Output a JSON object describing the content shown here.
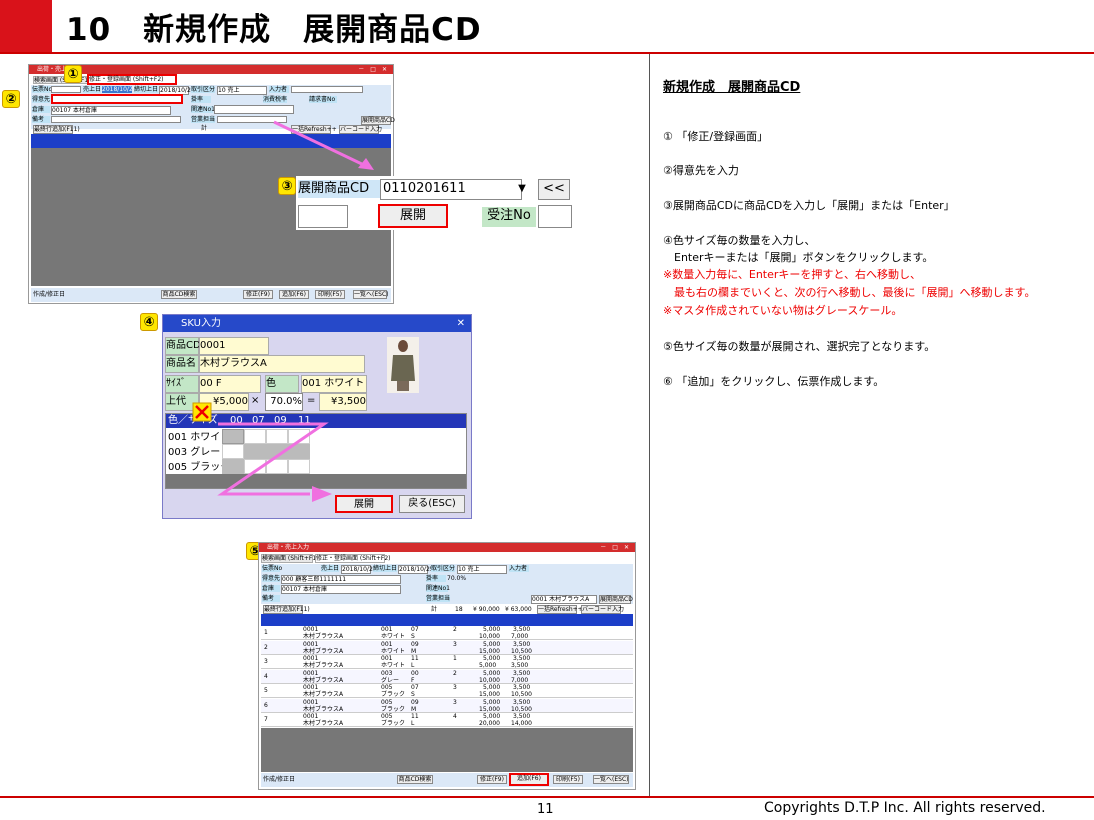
{
  "title": {
    "number": "10",
    "text": "新規作成　展開商品CD"
  },
  "footer": {
    "page": "11",
    "copyright": "Copyrights  D.T.P Inc. All rights reserved."
  },
  "instructions": {
    "heading": "新規作成　展開商品CD",
    "step1": "① 「修正/登録画面」",
    "step2": "②得意先を入力",
    "step3": "③展開商品CDに商品CDを入力し「展開」または「Enter」",
    "step4a": "④色サイズ毎の数量を入力し、",
    "step4b": "　Enterキーまたは「展開」ボタンをクリックします。",
    "note1a": "※数量入力毎に、Enterキーを押すと、右へ移動し、",
    "note1b": "　最も右の欄までいくと、次の行へ移動し、最後に「展開」へ移動します。",
    "note2": "※マスタ作成されていない物はグレースケール。",
    "step5": "⑤色サイズ毎の数量が展開され、選択完了となります。",
    "step6": "⑥ 「追加」をクリックし、伝票作成します。"
  },
  "callouts": {
    "c1": "①",
    "c2": "②",
    "c3": "③",
    "c4": "④",
    "c5": "⑤"
  },
  "screen1": {
    "title": "出荷・売上入力",
    "tab_search": "検索画面 (Shift+F1)",
    "tab_edit": "修正・登録画面 (Shift+F2)",
    "denpyo_no": "伝票No",
    "uriage_bi": "売上日",
    "uriage_date": "2018/10/25",
    "shime_bi": "締切上日",
    "shime_date": "2018/10/25",
    "torihiki": "取引区分",
    "torihiki_val": "10 売上",
    "nyuryokusha": "入力者",
    "tokuisaki": "得意先",
    "soko": "倉庫",
    "soko_val": "00107 本村倉庫",
    "bikou": "備考",
    "kakeritsu": "掛率",
    "shohizei": "消費税率",
    "seikyusho_no": "請求書No",
    "kanren_no": "関連No1",
    "eigyou_tanto": "営業担当",
    "tenkai_btn": "展開商品CD",
    "saishuu": "最終行追加(F11)",
    "kei": "計",
    "ikkatsu": "一括Refresh++",
    "barcode": "バーコード入力",
    "footer_label": "作成/修正日",
    "btn_search": "商品CD検索",
    "btn_fix": "修正(F9)",
    "btn_add": "追加(F6)",
    "btn_print": "印刷(F5)",
    "btn_list": "一覧へ(ESC)"
  },
  "zoom": {
    "label": "展開商品CD",
    "value": "0110201611",
    "arrow": "<<",
    "tenkai": "展開",
    "juchu": "受注No"
  },
  "sku": {
    "title": "SKU入力",
    "shohin_cd_label": "商品CD",
    "shohin_cd": "0001",
    "shohin_mei_label": "商品名",
    "shohin_mei": "木村ブラウスA",
    "size_label": "ｻｲｽﾞ",
    "size": "00 F",
    "iro_label": "色",
    "iro": "001 ホワイト",
    "jodai_label": "上代",
    "jodai": "¥5,000",
    "times": "×",
    "rate": "70.0%",
    "eq": "=",
    "result": "¥3,500",
    "grid_head": "色／サイズ",
    "sizes": [
      "00",
      "07",
      "09",
      "11"
    ],
    "rows": [
      "001 ホワイト",
      "003 グレー",
      "005 ブラック"
    ],
    "tenkai": "展開",
    "modoru": "戻る(ESC)"
  },
  "screen3": {
    "tokuisaki_val": "000 顧客三郎1111111",
    "kakeritsu_val": "70.0%",
    "kei_qty": "18",
    "kei_amt1": "¥ 90,000",
    "kei_amt2": "¥ 63,000",
    "tenkai_val": "0001 木村ブラウスA",
    "rows": [
      {
        "no": "1",
        "cd": "0001",
        "name": "木村ブラウスA",
        "color": "001",
        "cname": "ホワイト",
        "size": "07",
        "sname": "S",
        "qty": "2",
        "p1": "5,000",
        "p2": "3,500",
        "a1": "10,000",
        "a2": "7,000"
      },
      {
        "no": "2",
        "cd": "0001",
        "name": "木村ブラウスA",
        "color": "001",
        "cname": "ホワイト",
        "size": "09",
        "sname": "M",
        "qty": "3",
        "p1": "5,000",
        "p2": "3,500",
        "a1": "15,000",
        "a2": "10,500"
      },
      {
        "no": "3",
        "cd": "0001",
        "name": "木村ブラウスA",
        "color": "001",
        "cname": "ホワイト",
        "size": "11",
        "sname": "L",
        "qty": "1",
        "p1": "5,000",
        "p2": "3,500",
        "a1": "5,000",
        "a2": "3,500"
      },
      {
        "no": "4",
        "cd": "0001",
        "name": "木村ブラウスA",
        "color": "003",
        "cname": "グレー",
        "size": "00",
        "sname": "F",
        "qty": "2",
        "p1": "5,000",
        "p2": "3,500",
        "a1": "10,000",
        "a2": "7,000"
      },
      {
        "no": "5",
        "cd": "0001",
        "name": "木村ブラウスA",
        "color": "005",
        "cname": "ブラック",
        "size": "07",
        "sname": "S",
        "qty": "3",
        "p1": "5,000",
        "p2": "3,500",
        "a1": "15,000",
        "a2": "10,500"
      },
      {
        "no": "6",
        "cd": "0001",
        "name": "木村ブラウスA",
        "color": "005",
        "cname": "ブラック",
        "size": "09",
        "sname": "M",
        "qty": "3",
        "p1": "5,000",
        "p2": "3,500",
        "a1": "15,000",
        "a2": "10,500"
      },
      {
        "no": "7",
        "cd": "0001",
        "name": "木村ブラウスA",
        "color": "005",
        "cname": "ブラック",
        "size": "11",
        "sname": "L",
        "qty": "4",
        "p1": "5,000",
        "p2": "3,500",
        "a1": "20,000",
        "a2": "14,000"
      }
    ]
  }
}
